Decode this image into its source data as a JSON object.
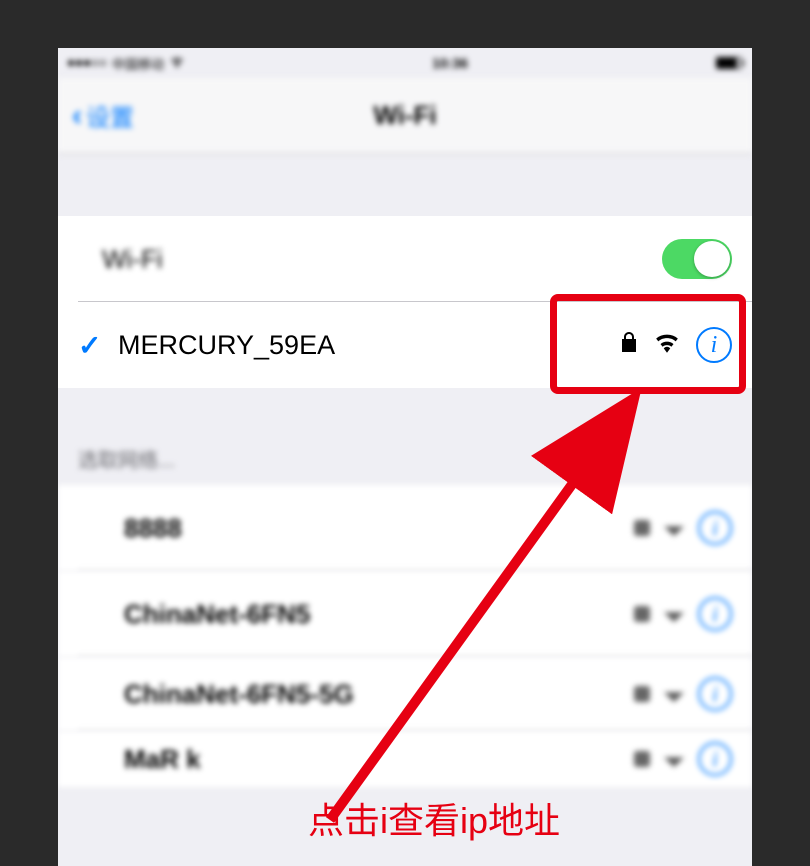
{
  "status_bar": {
    "carrier": "中国移动",
    "time": "10:36"
  },
  "nav": {
    "back_label": "设置",
    "title": "Wi-Fi"
  },
  "wifi_toggle": {
    "label": "Wi-Fi",
    "enabled": true
  },
  "connected_network": {
    "name": "MERCURY_59EA",
    "secured": true
  },
  "section_header": "选取网络...",
  "other_networks": [
    {
      "name": "8888"
    },
    {
      "name": "ChinaNet-6FN5"
    },
    {
      "name": "ChinaNet-6FN5-5G"
    },
    {
      "name": "MaR k"
    }
  ],
  "annotation": "点击i查看ip地址"
}
